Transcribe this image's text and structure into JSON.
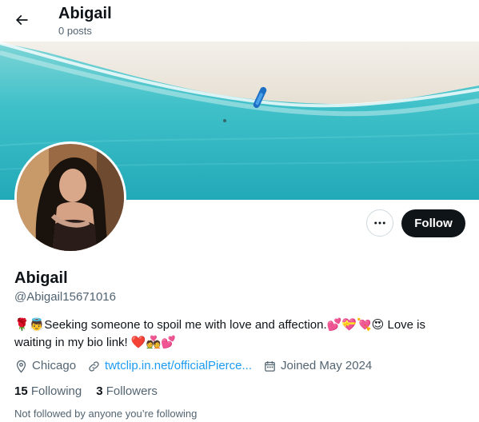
{
  "header": {
    "back_icon": "arrow-left-icon",
    "title": "Abigail",
    "subtitle": "0 posts"
  },
  "profile": {
    "name": "Abigail",
    "handle": "@Abigail15671016",
    "bio_prefix": "🌹👼",
    "bio_text": "Seeking someone to spoil me with love and affection.",
    "bio_emoji_mid": "💕💝💘😍",
    "bio_text2": " Love is waiting in my bio link! ",
    "bio_emoji_end": "❤️💑💕",
    "location": "Chicago",
    "link": "twtclip.in.net/officialPierce...",
    "joined": "Joined May 2024",
    "following_count": "15",
    "following_label": "Following",
    "followers_count": "3",
    "followers_label": "Followers",
    "not_followed": "Not followed by anyone you’re following"
  },
  "actions": {
    "more_icon": "more-horizontal-icon",
    "follow_label": "Follow"
  },
  "colors": {
    "accent": "#1d9bf0",
    "follow_bg": "#0f1419",
    "muted": "#536471"
  }
}
